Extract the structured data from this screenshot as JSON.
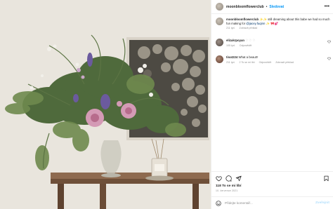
{
  "post": {
    "username": "moonbloomflowerclub",
    "follow_label": "Sledovat",
    "more_label": "•••"
  },
  "caption": {
    "username": "moonbloomflowerclub",
    "prefix": "✨✨ still dreaming about this babe we had so much fun making for ",
    "mention": "@jacey.fuqinn",
    "suffix": " ✨ 🎀💕",
    "time": "211 tyd.",
    "action": "Zobrazit překlad"
  },
  "comments": [
    {
      "username": "elizakrpoyan",
      "text": "♡ ♡ ♡",
      "time": "105 tyd.",
      "reply": "Odpovědět",
      "likes": "",
      "translate": ""
    },
    {
      "username": "tinat224",
      "text": "What a beaut!!",
      "time": "211 tyd.",
      "likes": "2 To se mi líbí",
      "reply": "Odpovědět",
      "translate": "Zobrazit překlad"
    }
  ],
  "actions": {
    "like_icon": "heart-icon",
    "comment_icon": "comment-icon",
    "share_icon": "share-icon",
    "save_icon": "bookmark-icon"
  },
  "likes_count": "118 To se mi líbí",
  "date": "10. července 2021",
  "add_comment": {
    "placeholder": "Přidejte komentář...",
    "post_label": "Zveřejnit",
    "emoji_icon": "smiley-icon"
  },
  "colors": {
    "link_blue": "#0095f6",
    "post_btn_disabled": "#b2dffc",
    "meta_gray": "#8e8e8e"
  }
}
